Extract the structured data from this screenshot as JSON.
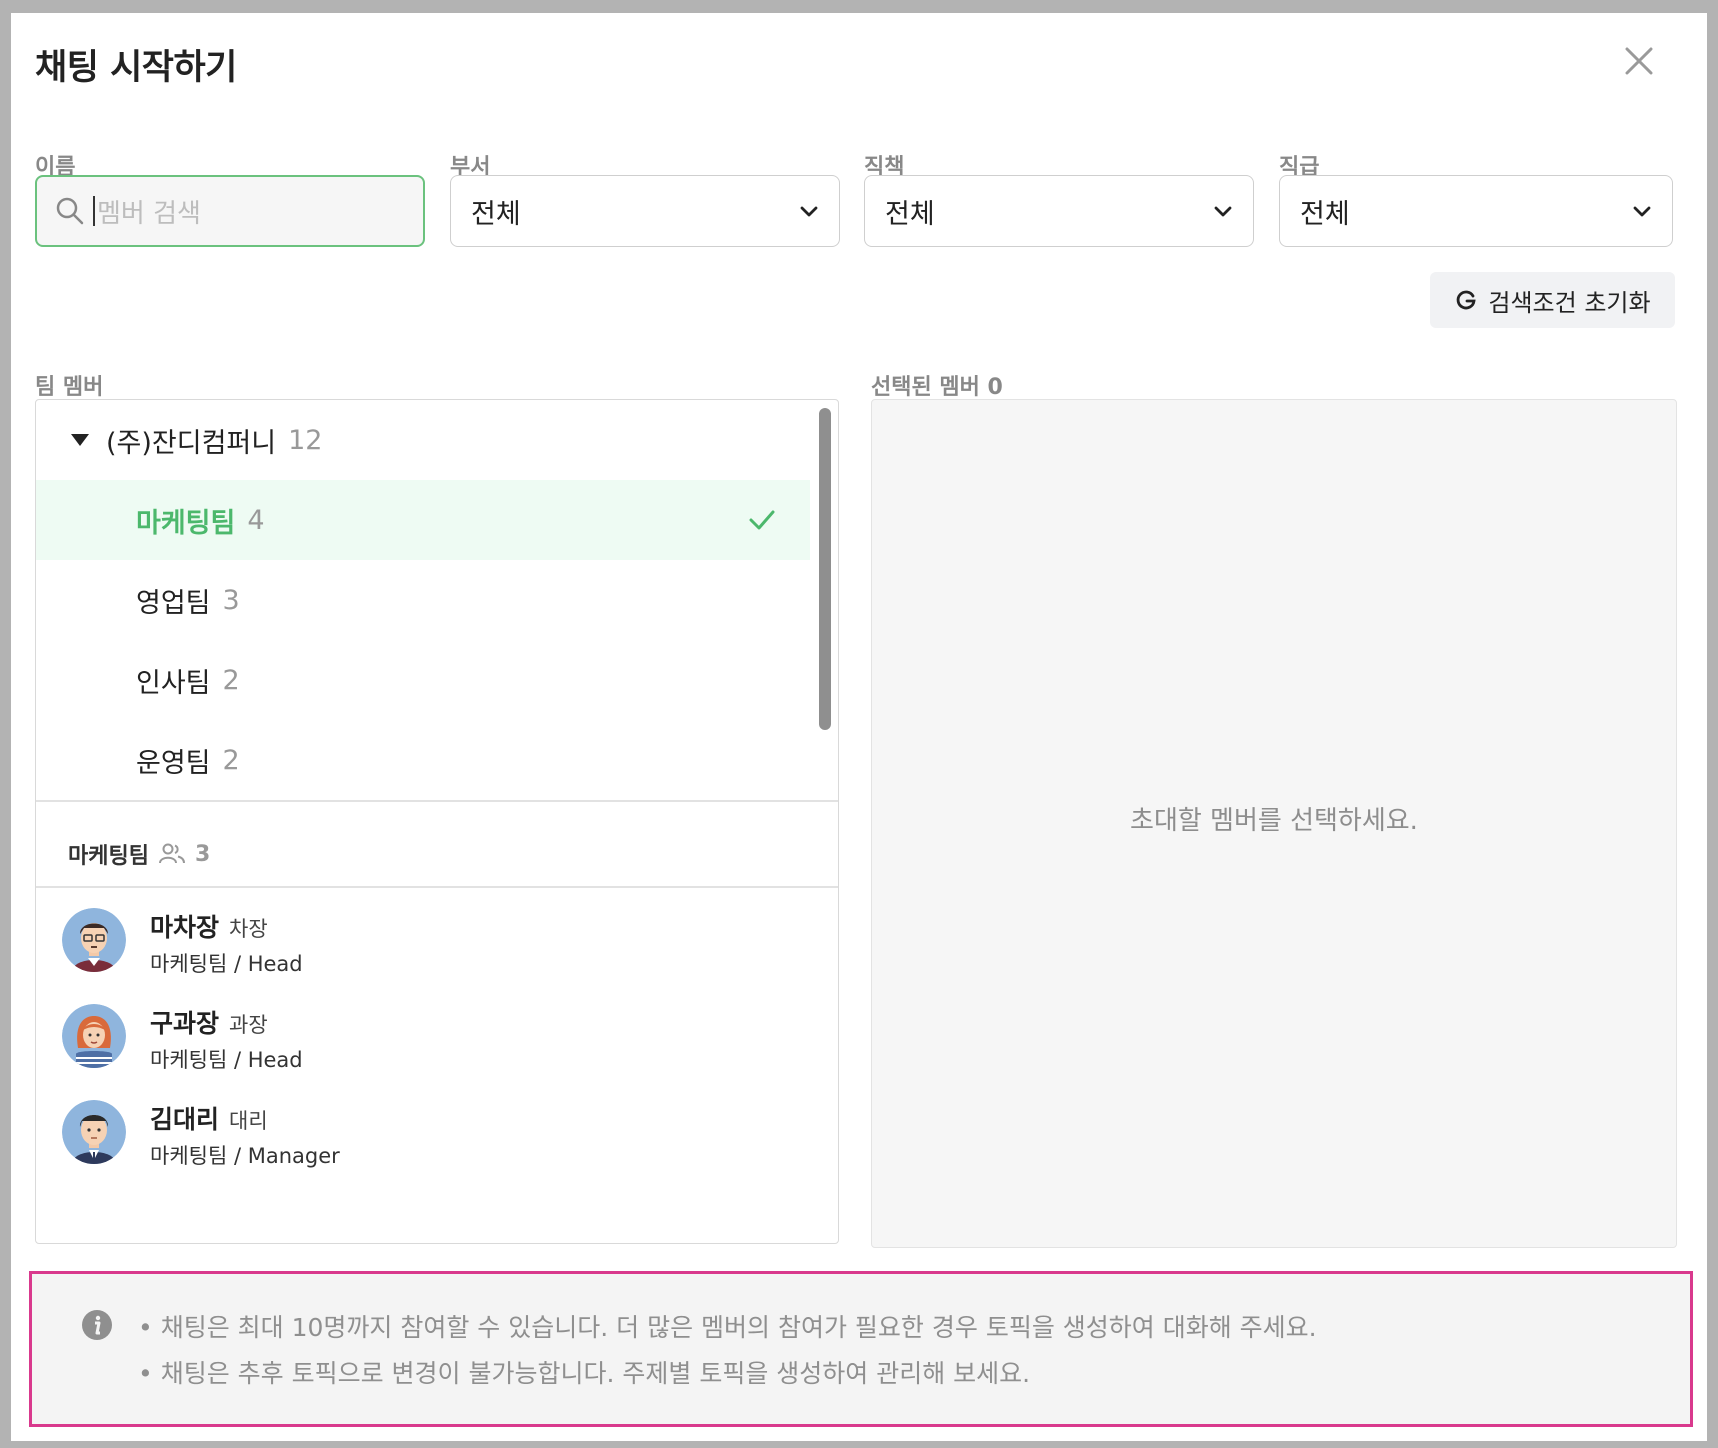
{
  "dialog": {
    "title": "채팅 시작하기"
  },
  "filters": {
    "name": {
      "label": "이름",
      "placeholder": "멤버 검색",
      "value": ""
    },
    "dept": {
      "label": "부서",
      "value": "전체"
    },
    "role": {
      "label": "직책",
      "value": "전체"
    },
    "rank": {
      "label": "직급",
      "value": "전체"
    },
    "reset_label": "검색조건 초기화"
  },
  "team": {
    "label": "팀 멤버",
    "root": {
      "name": "(주)잔디컴퍼니",
      "count": "12"
    },
    "teams": [
      {
        "name": "마케팅팀",
        "count": "4",
        "selected": true
      },
      {
        "name": "영업팀",
        "count": "3"
      },
      {
        "name": "인사팀",
        "count": "2"
      },
      {
        "name": "운영팀",
        "count": "2"
      }
    ],
    "group": {
      "name": "마케팅팀",
      "count": "3"
    },
    "members": [
      {
        "name": "마차장",
        "title": "차장",
        "dept": "마케팅팀 / Head"
      },
      {
        "name": "구과장",
        "title": "과장",
        "dept": "마케팅팀 / Head"
      },
      {
        "name": "김대리",
        "title": "대리",
        "dept": "마케팅팀 / Manager"
      }
    ]
  },
  "selected": {
    "label": "선택된 멤버 0",
    "empty_text": "초대할 멤버를 선택하세요."
  },
  "notice": {
    "lines": [
      "• 채팅은 최대 10명까지 참여할 수 있습니다. 더 많은 멤버의 참여가 필요한 경우 토픽을 생성하여 대화해 주세요.",
      "• 채팅은 추후 토픽으로 변경이 불가능합니다. 주제별 토픽을 생성하여 관리해 보세요."
    ]
  },
  "colors": {
    "accent": "#4cb86c",
    "selected_bg": "#eefbf3",
    "notice_border": "#d9398d"
  }
}
